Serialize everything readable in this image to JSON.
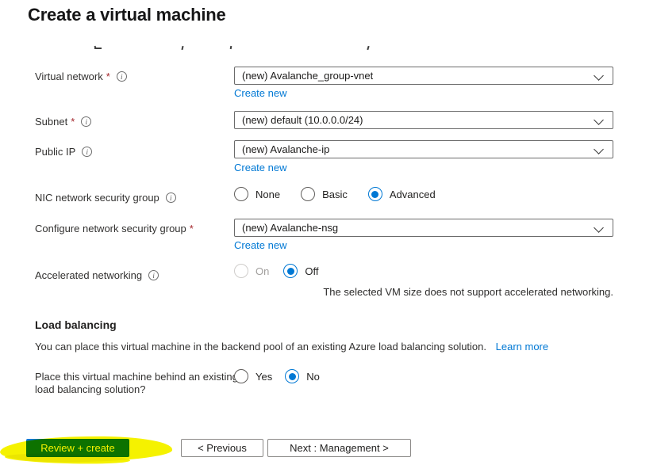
{
  "page": {
    "title": "Create a virtual machine"
  },
  "colors": {
    "link": "#0078d4",
    "radio_selected": "#0078d4",
    "required_asterisk": "#a4262c",
    "primary_button": "#0d78d4",
    "marker_highlight": "#f5f200"
  },
  "form": {
    "virtual_network": {
      "label": "Virtual network",
      "required": "*",
      "value": "(new) Avalanche_group-vnet",
      "create_new": "Create new"
    },
    "subnet": {
      "label": "Subnet",
      "required": "*",
      "value": "(new) default (10.0.0.0/24)"
    },
    "public_ip": {
      "label": "Public IP",
      "value": "(new) Avalanche-ip",
      "create_new": "Create new"
    },
    "nic_nsg": {
      "label": "NIC network security group",
      "options": [
        "None",
        "Basic",
        "Advanced"
      ],
      "selected": "Advanced"
    },
    "configure_nsg": {
      "label": "Configure network security group",
      "required": "*",
      "value": "(new) Avalanche-nsg",
      "create_new": "Create new"
    },
    "accelerated_networking": {
      "label": "Accelerated networking",
      "options": [
        "On",
        "Off"
      ],
      "selected": "Off",
      "disabled_option": "On",
      "note": "The selected VM size does not support accelerated networking."
    },
    "load_balancing": {
      "heading": "Load balancing",
      "description": "You can place this virtual machine in the backend pool of an existing Azure load balancing solution.",
      "learn_more": "Learn more",
      "question": "Place this virtual machine behind an existing load balancing solution?",
      "options": [
        "Yes",
        "No"
      ],
      "selected": "No"
    }
  },
  "footer": {
    "review_create": "Review + create",
    "previous": "< Previous",
    "next": "Next : Management >"
  }
}
